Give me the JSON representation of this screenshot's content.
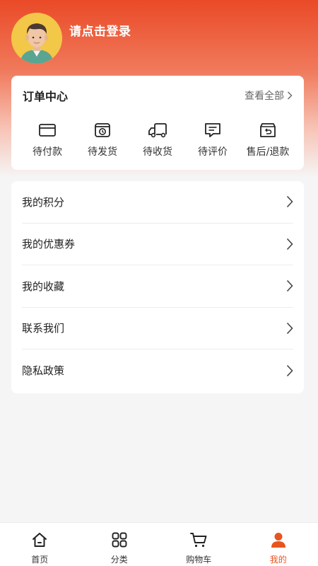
{
  "profile": {
    "login_text": "请点击登录"
  },
  "orders": {
    "title": "订单中心",
    "view_all": "查看全部",
    "items": [
      {
        "label": "待付款",
        "icon": "wallet-icon"
      },
      {
        "label": "待发货",
        "icon": "package-clock-icon"
      },
      {
        "label": "待收货",
        "icon": "truck-icon"
      },
      {
        "label": "待评价",
        "icon": "comment-icon"
      },
      {
        "label": "售后/退款",
        "icon": "return-box-icon"
      }
    ]
  },
  "menu": [
    {
      "label": "我的积分"
    },
    {
      "label": "我的优惠券"
    },
    {
      "label": "我的收藏"
    },
    {
      "label": "联系我们"
    },
    {
      "label": "隐私政策"
    }
  ],
  "tabbar": {
    "tabs": [
      {
        "label": "首页",
        "icon": "home-icon"
      },
      {
        "label": "分类",
        "icon": "category-grid-icon"
      },
      {
        "label": "购物车",
        "icon": "cart-icon"
      },
      {
        "label": "我的",
        "icon": "user-icon",
        "active": true
      }
    ]
  },
  "colors": {
    "accent": "#e8541f",
    "header": "#ea4a27",
    "avatar_bg": "#f3c747"
  }
}
